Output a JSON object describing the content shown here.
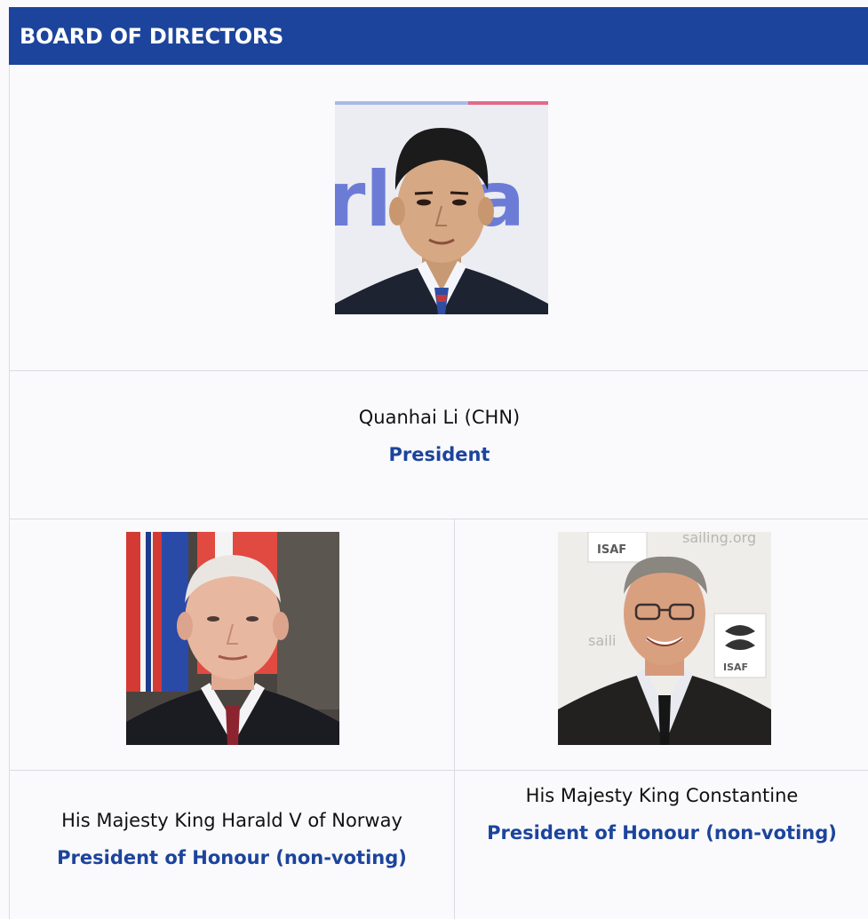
{
  "header": {
    "title": "BOARD OF DIRECTORS"
  },
  "colors": {
    "header_bg": "#1c449c",
    "role_text": "#1c449c",
    "name_text": "#111111"
  },
  "members": [
    {
      "name": "Quanhai Li (CHN)",
      "role": "President"
    },
    {
      "name": "His Majesty King Harald V of Norway",
      "role": "President of Honour (non-voting)"
    },
    {
      "name": "His Majesty King Constantine",
      "role": "President of Honour (non-voting)"
    }
  ],
  "photo_logos": {
    "backdrop_text_1": "rl Sa",
    "isaf_1": "ISAF",
    "isaf_2": "ISAF",
    "sailing_url": "sailing.org",
    "saili": "saili"
  }
}
